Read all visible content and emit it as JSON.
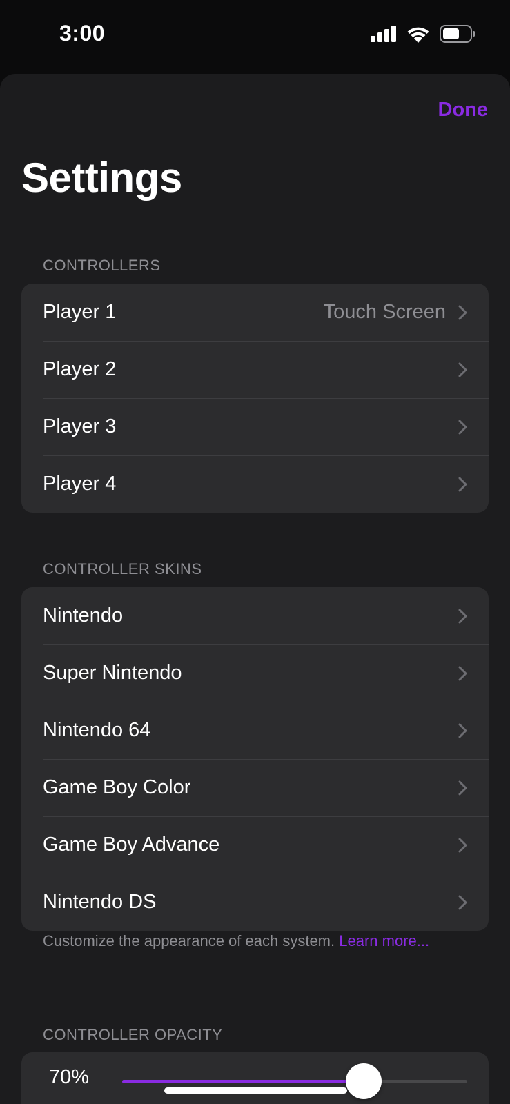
{
  "status_bar": {
    "time": "3:00",
    "icons": [
      "cellular-signal-icon",
      "wifi-icon",
      "battery-icon"
    ]
  },
  "accent_color": "#8a2be2",
  "header": {
    "done_label": "Done",
    "title": "Settings"
  },
  "controllers": {
    "header": "CONTROLLERS",
    "items": [
      {
        "label": "Player 1",
        "detail": "Touch Screen"
      },
      {
        "label": "Player 2",
        "detail": ""
      },
      {
        "label": "Player 3",
        "detail": ""
      },
      {
        "label": "Player 4",
        "detail": ""
      }
    ]
  },
  "controller_skins": {
    "header": "CONTROLLER SKINS",
    "items": [
      {
        "label": "Nintendo"
      },
      {
        "label": "Super Nintendo"
      },
      {
        "label": "Nintendo 64"
      },
      {
        "label": "Game Boy Color"
      },
      {
        "label": "Game Boy Advance"
      },
      {
        "label": "Nintendo DS"
      }
    ],
    "footer_text": "Customize the appearance of each system. ",
    "footer_link": "Learn more..."
  },
  "controller_opacity": {
    "header": "CONTROLLER OPACITY",
    "value_label": "70%",
    "value": 0.7
  }
}
